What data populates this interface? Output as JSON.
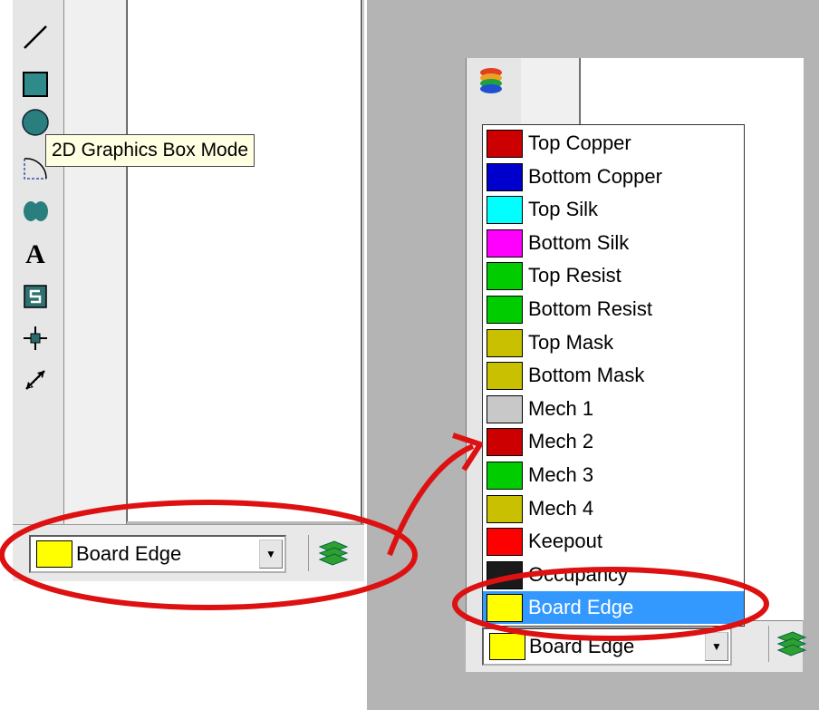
{
  "left_panel": {
    "tooltip": "2D Graphics Box Mode",
    "layer_combo": {
      "value": "Board Edge",
      "swatch_color": "#ffff00"
    },
    "tools": [
      "line-icon",
      "box-icon",
      "circle-icon",
      "arc-icon",
      "path-icon",
      "text-icon",
      "symbol-icon",
      "marker-icon",
      "dimension-icon"
    ]
  },
  "right_panel": {
    "layer_combo": {
      "value": "Board Edge",
      "swatch_color": "#ffff00"
    },
    "dropdown": {
      "options": [
        {
          "label": "Top Copper",
          "color": "#cc0000"
        },
        {
          "label": "Bottom Copper",
          "color": "#0000cc"
        },
        {
          "label": "Top Silk",
          "color": "#00ffff"
        },
        {
          "label": "Bottom Silk",
          "color": "#ff00ff"
        },
        {
          "label": "Top Resist",
          "color": "#00cc00"
        },
        {
          "label": "Bottom Resist",
          "color": "#00cc00"
        },
        {
          "label": "Top Mask",
          "color": "#c8c000"
        },
        {
          "label": "Bottom Mask",
          "color": "#c8c000"
        },
        {
          "label": "Mech 1",
          "color": "#c8c8c8"
        },
        {
          "label": "Mech 2",
          "color": "#cc0000"
        },
        {
          "label": "Mech 3",
          "color": "#00cc00"
        },
        {
          "label": "Mech 4",
          "color": "#c8c000"
        },
        {
          "label": "Keepout",
          "color": "#ff0000"
        },
        {
          "label": "Occupancy",
          "color": "#1a1a1a"
        },
        {
          "label": "Board Edge",
          "color": "#ffff00"
        }
      ],
      "selected": "Board Edge"
    }
  },
  "colors": {
    "annotation_red": "#dd1111",
    "selection_blue": "#3399ff"
  }
}
